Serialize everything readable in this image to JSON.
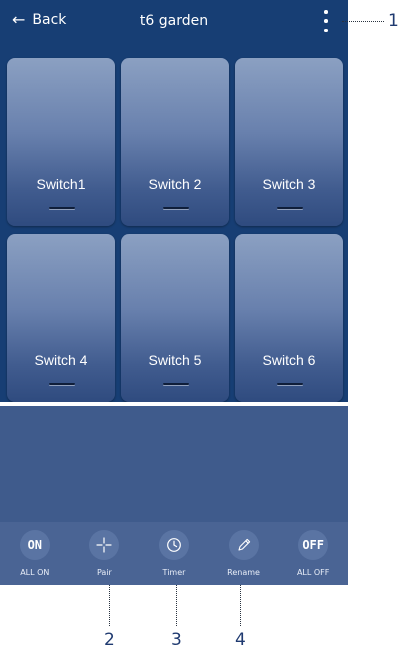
{
  "header": {
    "back_label": "Back",
    "title": "t6 garden"
  },
  "switches": [
    {
      "label": "Switch1"
    },
    {
      "label": "Switch 2"
    },
    {
      "label": "Switch 3"
    },
    {
      "label": "Switch 4"
    },
    {
      "label": "Switch 5"
    },
    {
      "label": "Switch 6"
    }
  ],
  "actions": [
    {
      "icon_text": "ON",
      "label": "ALL ON"
    },
    {
      "icon": "pair-crosshair-icon",
      "label": "Pair"
    },
    {
      "icon": "clock-icon",
      "label": "Timer"
    },
    {
      "icon": "pencil-icon",
      "label": "Rename"
    },
    {
      "icon_text": "OFF",
      "label": "ALL OFF"
    }
  ],
  "callouts": [
    "1",
    "2",
    "3",
    "4"
  ],
  "colors": {
    "screen_background": "#173e74",
    "tile_top": "#8ba0c2",
    "tile_bottom": "#2f4b7f",
    "bottom_panel": "#3f5b8c",
    "action_bar": "#4a6494",
    "callout_text": "#1f3a70"
  }
}
